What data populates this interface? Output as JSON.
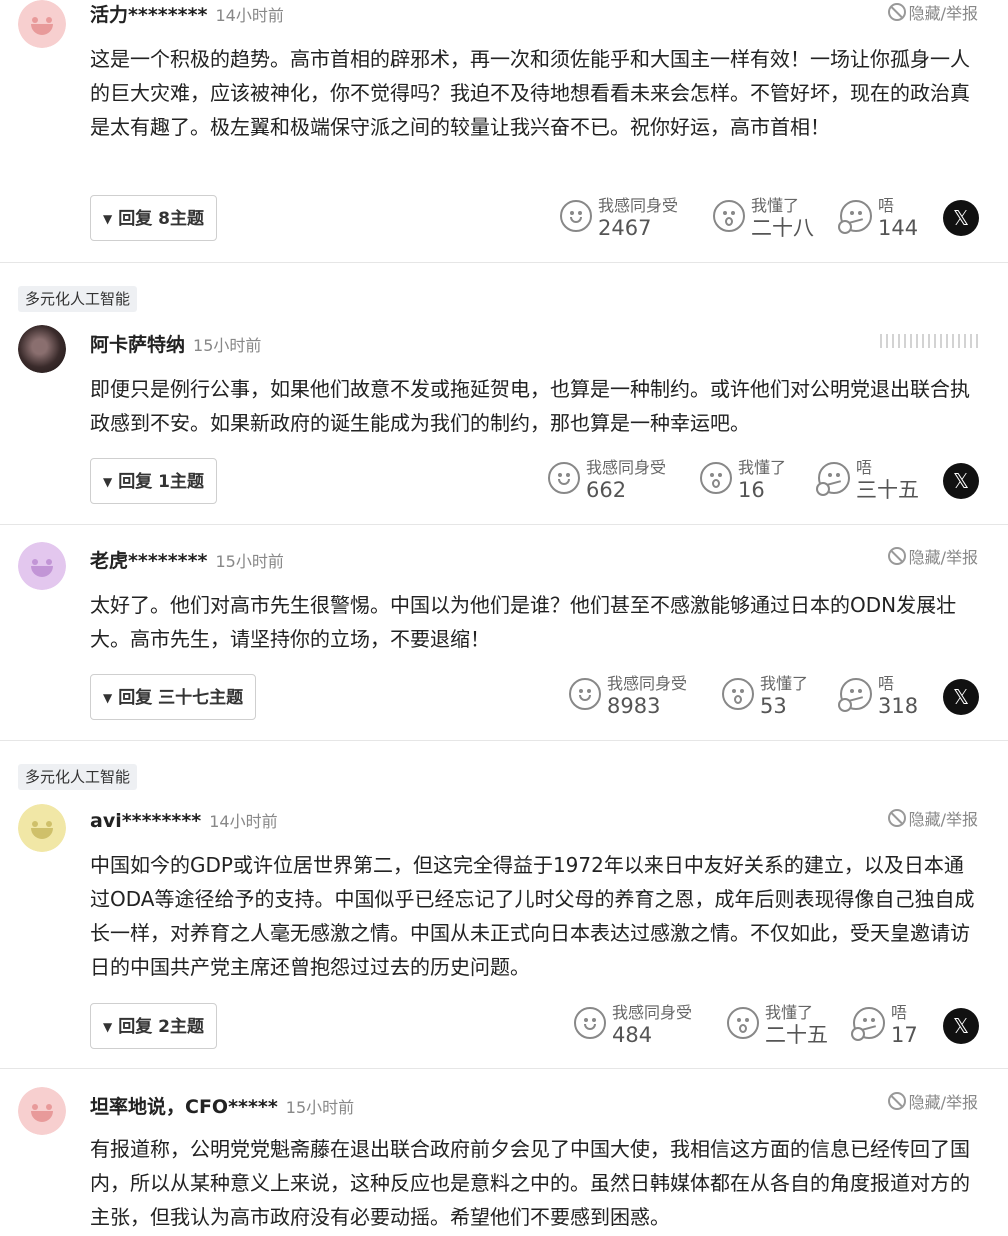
{
  "report_label": "隐藏/举报",
  "reaction_labels": {
    "empathy": "我感同身受",
    "understood": "我懂了",
    "hmm": "唔"
  },
  "share_icon": "x-logo-icon",
  "section_tag": "多元化人工智能",
  "colors": {
    "pink_avatar": "#f7cfcf",
    "purple_avatar": "#e3c7ee",
    "yellow_avatar": "#f1e7a6"
  },
  "comments": [
    {
      "user": "活力********",
      "time": "14小时前",
      "text": "这是一个积极的趋势。高市首相的辟邪术，再一次和须佐能乎和大国主一样有效！一场让你孤身一人的巨大灾难，应该被神化，你不觉得吗？我迫不及待地想看看未来会怎样。不管好坏，现在的政治真是太有趣了。极左翼和极端保守派之间的较量让我兴奋不已。祝你好运，高市首相！",
      "reply": "回复 8主题",
      "empathy": "2467",
      "understood": "二十八",
      "hmm": "144"
    },
    {
      "user": "阿卡萨特纳",
      "time": "15小时前",
      "text": "即便只是例行公事，如果他们故意不发或拖延贺电，也算是一种制约。或许他们对公明党退出联合执政感到不安。如果新政府的诞生能成为我们的制约，那也算是一种幸运吧。",
      "reply": "回复 1主题",
      "empathy": "662",
      "understood": "16",
      "hmm": "三十五"
    },
    {
      "user": "老虎********",
      "time": "15小时前",
      "text": "太好了。他们对高市先生很警惕。中国以为他们是谁？他们甚至不感激能够通过日本的ODN发展壮大。高市先生，请坚持你的立场，不要退缩！",
      "reply": "回复 三十七主题",
      "empathy": "8983",
      "understood": "53",
      "hmm": "318"
    },
    {
      "user": "avi********",
      "time": "14小时前",
      "text": "中国如今的GDP或许位居世界第二，但这完全得益于1972年以来日中友好关系的建立，以及日本通过ODA等途径给予的支持。中国似乎已经忘记了儿时父母的养育之恩，成年后则表现得像自己独自成长一样，对养育之人毫无感激之情。中国从未正式向日本表达过感激之情。不仅如此，受天皇邀请访日的中国共产党主席还曾抱怨过过去的历史问题。",
      "reply": "回复 2主题",
      "empathy": "484",
      "understood": "二十五",
      "hmm": "17"
    },
    {
      "user": "坦率地说，CFO*****",
      "time": "15小时前",
      "text": "有报道称，公明党党魁斋藤在退出联合政府前夕会见了中国大使，我相信这方面的信息已经传回了国内，所以从某种意义上来说，这种反应也是意料之中的。虽然日韩媒体都在从各自的角度报道对方的主张，但我认为高市政府没有必要动摇。希望他们不要感到困惑。"
    }
  ]
}
